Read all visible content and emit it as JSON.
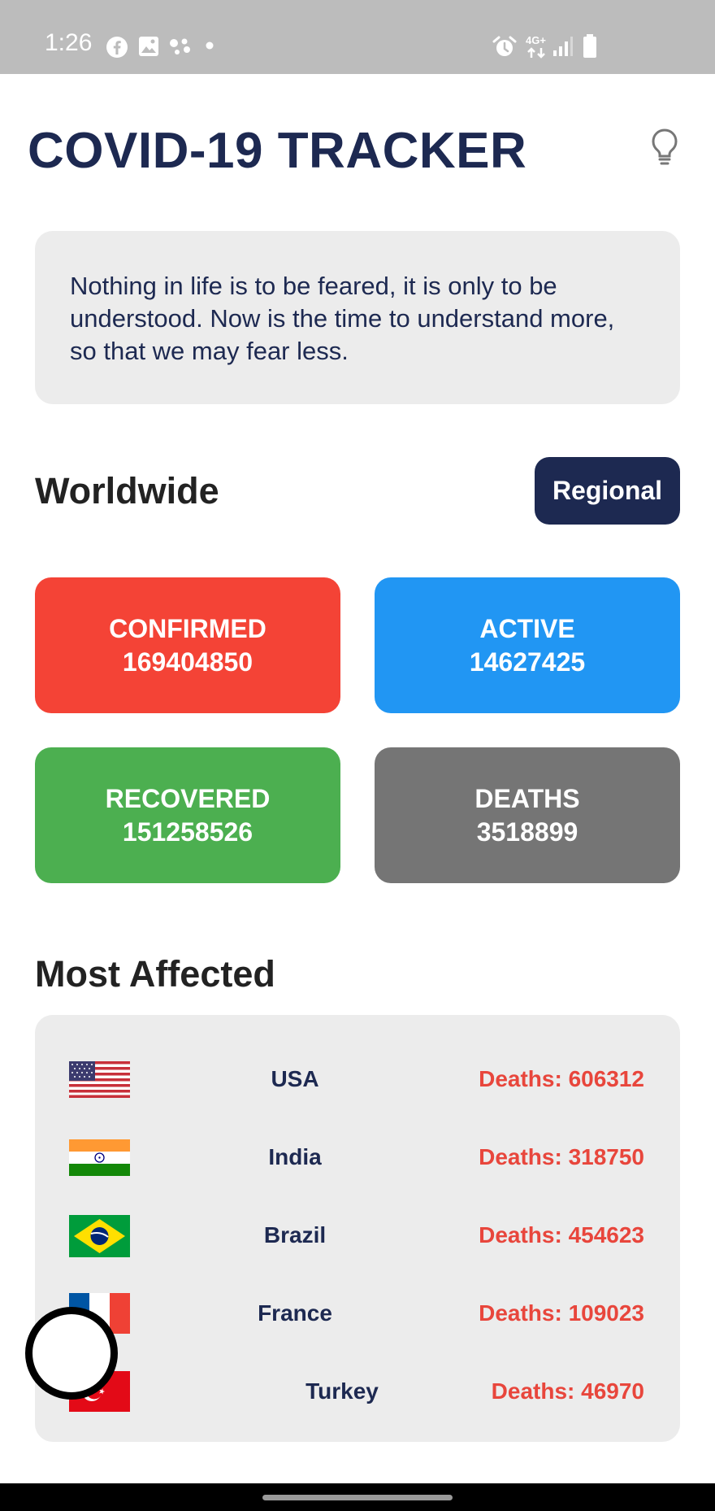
{
  "status_bar": {
    "time": "1:26",
    "left_icons": [
      "facebook-icon",
      "gallery-icon",
      "assistant-icon",
      "dot-icon"
    ],
    "right_icons": [
      "alarm-icon",
      "4g-data-icon",
      "signal-icon",
      "battery-icon"
    ],
    "network_label": "4G+"
  },
  "header": {
    "title": "COVID-19 TRACKER",
    "theme_icon": "lightbulb-icon"
  },
  "quote": {
    "text": "Nothing in life is to be feared, it is only to be understood. Now is the time to understand more, so that we may fear less."
  },
  "worldwide": {
    "title": "Worldwide",
    "regional_label": "Regional",
    "stats": [
      {
        "label": "CONFIRMED",
        "value": "169404850",
        "color": "#f44336"
      },
      {
        "label": "ACTIVE",
        "value": "14627425",
        "color": "#2196f3"
      },
      {
        "label": "RECOVERED",
        "value": "151258526",
        "color": "#4caf50"
      },
      {
        "label": "DEATHS",
        "value": "3518899",
        "color": "#757575"
      }
    ]
  },
  "most_affected": {
    "title": "Most Affected",
    "countries": [
      {
        "name": "USA",
        "deaths": "Deaths: 606312",
        "flag": "usa-flag-icon"
      },
      {
        "name": "India",
        "deaths": "Deaths: 318750",
        "flag": "india-flag-icon"
      },
      {
        "name": "Brazil",
        "deaths": "Deaths: 454623",
        "flag": "brazil-flag-icon"
      },
      {
        "name": "France",
        "deaths": "Deaths: 109023",
        "flag": "france-flag-icon"
      },
      {
        "name": "Turkey",
        "deaths": "Deaths: 46970",
        "flag": "turkey-flag-icon"
      }
    ]
  },
  "colors": {
    "navy": "#1d2951",
    "deaths_text": "#e8463c",
    "card_bg": "#ececec"
  }
}
